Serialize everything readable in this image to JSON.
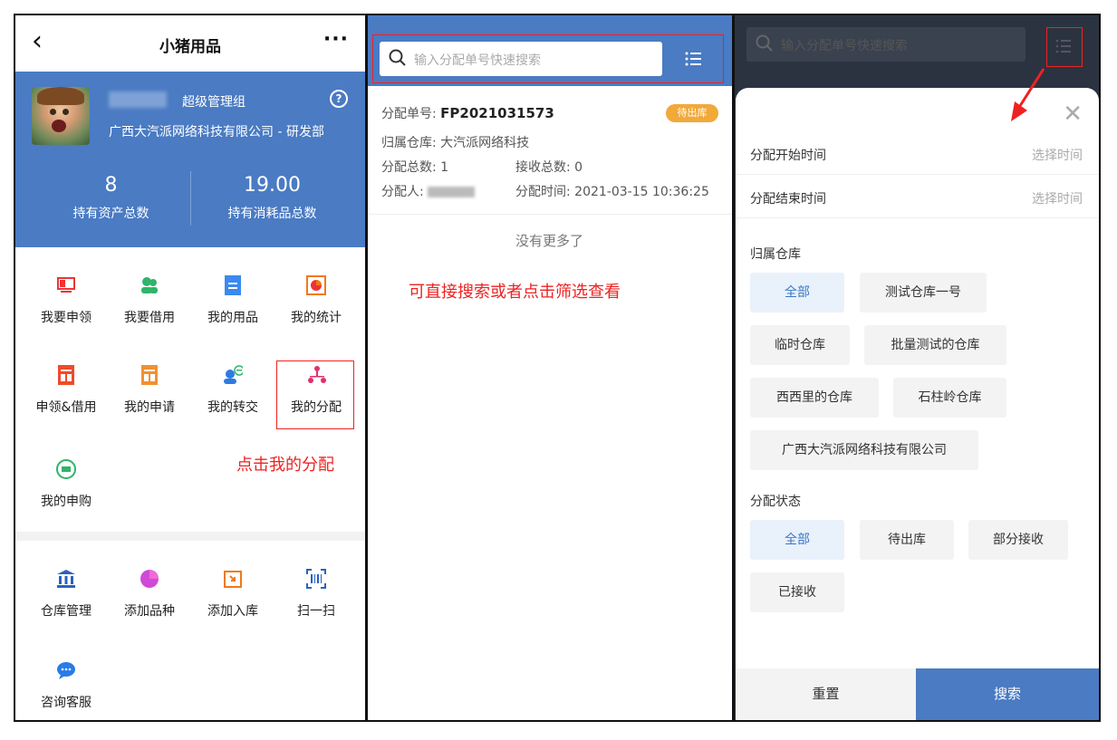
{
  "left": {
    "header": {
      "back_icon": "chevron-left-icon",
      "title": "小猪用品",
      "more": "···"
    },
    "profile": {
      "role": "超级管理组",
      "help": "?",
      "org": "广西大汽派网络科技有限公司 - 研发部"
    },
    "stats": [
      {
        "value": "8",
        "label": "持有资产总数"
      },
      {
        "value": "19.00",
        "label": "持有消耗品总数"
      }
    ],
    "menu1": [
      {
        "label": "我要申领",
        "icon": "monitor-icon"
      },
      {
        "label": "我要借用",
        "icon": "people-icon"
      },
      {
        "label": "我的用品",
        "icon": "document-icon"
      },
      {
        "label": "我的统计",
        "icon": "pie-chart-icon"
      },
      {
        "label": "申领&借用",
        "icon": "form-icon"
      },
      {
        "label": "我的申请",
        "icon": "form-icon"
      },
      {
        "label": "我的转交",
        "icon": "transfer-icon"
      },
      {
        "label": "我的分配",
        "icon": "distribute-icon"
      },
      {
        "label": "我的申购",
        "icon": "cart-icon"
      }
    ],
    "menu2": [
      {
        "label": "仓库管理",
        "icon": "bank-icon"
      },
      {
        "label": "添加品种",
        "icon": "pie-icon"
      },
      {
        "label": "添加入库",
        "icon": "import-icon"
      },
      {
        "label": "扫一扫",
        "icon": "scan-icon"
      },
      {
        "label": "咨询客服",
        "icon": "chat-icon"
      }
    ],
    "annotation": "点击我的分配"
  },
  "middle": {
    "search_placeholder": "输入分配单号快速搜索",
    "card": {
      "no_label": "分配单号:",
      "no_value": "FP2021031573",
      "badge": "待出库",
      "warehouse": "归属仓库: 大汽派网络科技",
      "total": "分配总数: 1",
      "received": "接收总数: 0",
      "assigner": "分配人:",
      "time": "分配时间: 2021-03-15 10:36:25"
    },
    "no_more": "没有更多了",
    "annotation": "可直接搜索或者点击筛选查看"
  },
  "right": {
    "search_placeholder": "输入分配单号快速搜索",
    "start_time": {
      "label": "分配开始时间",
      "value": "选择时间"
    },
    "end_time": {
      "label": "分配结束时间",
      "value": "选择时间"
    },
    "warehouse_title": "归属仓库",
    "warehouses": [
      "全部",
      "测试仓库一号",
      "临时仓库",
      "批量测试的仓库",
      "西西里的仓库",
      "石柱岭仓库",
      "广西大汽派网络科技有限公司"
    ],
    "status_title": "分配状态",
    "statuses": [
      "全部",
      "待出库",
      "部分接收",
      "已接收"
    ],
    "reset": "重置",
    "search": "搜索"
  },
  "colors": {
    "primary": "#4a7bc3",
    "accent_red": "#e22",
    "badge": "#f1a93a"
  }
}
